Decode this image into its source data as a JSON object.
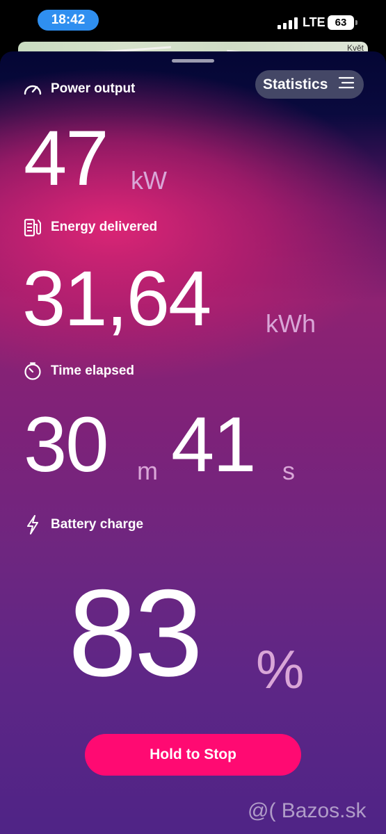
{
  "status_bar": {
    "time": "18:42",
    "network": "LTE",
    "battery_level": "63"
  },
  "map": {
    "place_label": "Květ"
  },
  "header": {
    "power_label": "Power output",
    "statistics_label": "Statistics"
  },
  "power": {
    "value": "47",
    "unit": "kW"
  },
  "energy": {
    "label": "Energy delivered",
    "value": "31,64",
    "unit": "kWh"
  },
  "time_elapsed": {
    "label": "Time elapsed",
    "minutes": "30",
    "minutes_unit": "m",
    "seconds": "41",
    "seconds_unit": "s"
  },
  "battery": {
    "label": "Battery charge",
    "value": "83",
    "unit": "%"
  },
  "actions": {
    "stop_label": "Hold to Stop"
  },
  "watermark": "@( Bazos.sk",
  "colors": {
    "accent": "#ff0a72",
    "time_pill": "#2f8ff0",
    "unit_text": "#d9a6d7",
    "sheet_top": "#040634",
    "sheet_bottom": "#4f2486"
  },
  "icons": [
    "speedometer-icon",
    "ev-charger-icon",
    "timer-icon",
    "lightning-icon",
    "menu-lines-icon"
  ]
}
